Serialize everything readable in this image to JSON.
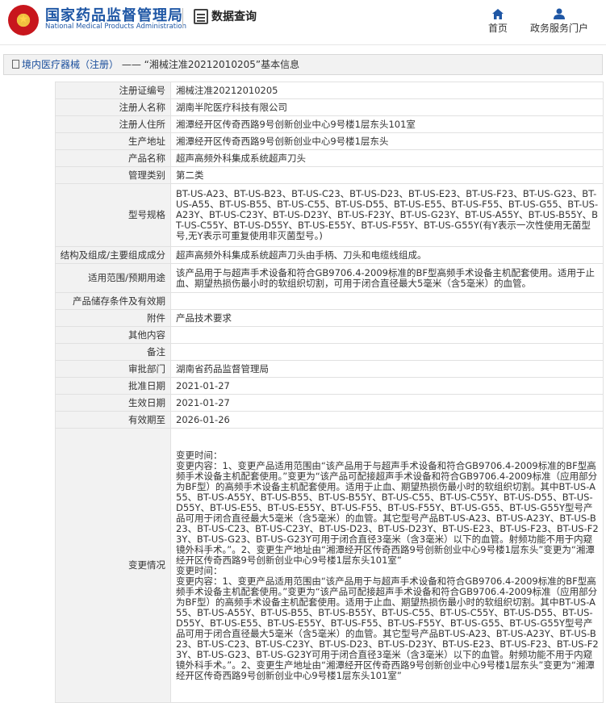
{
  "header": {
    "brand_cn": "国家药品监督管理局",
    "brand_en": "National Medical Products Administration",
    "section_title": "数据查询",
    "nav": {
      "home": "首页",
      "gov": "政务服务门户"
    },
    "brand_color": "#1f57a5"
  },
  "breadcrumb": {
    "category": "境内医疗器械（注册）",
    "sep": " —— ",
    "detail": "“湘械注准20212010205”基本信息"
  },
  "rows": [
    {
      "label": "注册证编号",
      "value": "湘械注准20212010205"
    },
    {
      "label": "注册人名称",
      "value": "湖南半陀医疗科技有限公司"
    },
    {
      "label": "注册人住所",
      "value": "湘潭经开区传奇西路9号创新创业中心9号楼1层东头101室"
    },
    {
      "label": "生产地址",
      "value": "湘潭经开区传奇西路9号创新创业中心9号楼1层东头"
    },
    {
      "label": "产品名称",
      "value": "超声高频外科集成系统超声刀头"
    },
    {
      "label": "管理类别",
      "value": "第二类"
    },
    {
      "label": "型号规格",
      "value": "BT-US-A23、BT-US-B23、BT-US-C23、BT-US-D23、BT-US-E23、BT-US-F23、BT-US-G23、BT-US-A55、BT-US-B55、BT-US-C55、BT-US-D55、BT-US-E55、BT-US-F55、BT-US-G55、BT-US-A23Y、BT-US-C23Y、BT-US-D23Y、BT-US-F23Y、BT-US-G23Y、BT-US-A55Y、BT-US-B55Y、BT-US-C55Y、BT-US-D55Y、BT-US-E55Y、BT-US-F55Y、BT-US-G55Y(有Y表示一次性使用无菌型号,无Y表示可重复使用非灭菌型号。)"
    },
    {
      "label": "结构及组成/主要组成成分",
      "value": "超声高频外科集成系统超声刀头由手柄、刀头和电缆线组成。"
    },
    {
      "label": "适用范围/预期用途",
      "value": "该产品用于与超声手术设备和符合GB9706.4-2009标准的BF型高频手术设备主机配套使用。适用于止血、期望热损伤最小时的软组织切割，可用于闭合直径最大5毫米（含5毫米）的血管。"
    },
    {
      "label": "产品储存条件及有效期",
      "value": ""
    },
    {
      "label": "附件",
      "value": "产品技术要求"
    },
    {
      "label": "其他内容",
      "value": ""
    },
    {
      "label": "备注",
      "value": ""
    },
    {
      "label": "审批部门",
      "value": "湖南省药品监督管理局"
    },
    {
      "label": "批准日期",
      "value": "2021-01-27"
    },
    {
      "label": "生效日期",
      "value": "2021-01-27"
    },
    {
      "label": "有效期至",
      "value": "2026-01-26"
    },
    {
      "label": "变更情况",
      "value": "变更时间：\n变更内容：1、变更产品适用范围由“该产品用于与超声手术设备和符合GB9706.4-2009标准的BF型高频手术设备主机配套使用。”变更为“该产品可配接超声手术设备和符合GB9706.4-2009标准（应用部分为BF型）的高频手术设备主机配套使用。适用于止血、期望热损伤最小时的软组织切割。其中BT-US-A55、BT-US-A55Y、BT-US-B55、BT-US-B55Y、BT-US-C55、BT-US-C55Y、BT-US-D55、BT-US-D55Y、BT-US-E55、BT-US-E55Y、BT-US-F55、BT-US-F55Y、BT-US-G55、BT-US-G55Y型号产品可用于闭合直径最大5毫米（含5毫米）的血管。其它型号产品BT-US-A23、BT-US-A23Y、BT-US-B23、BT-US-C23、BT-US-C23Y、BT-US-D23、BT-US-D23Y、BT-US-E23、BT-US-F23、BT-US-F23Y、BT-US-G23、BT-US-G23Y可用于闭合直径3毫米（含3毫米）以下的血管。射频功能不用于内窥镜外科手术。”。2、变更生产地址由“湘潭经开区传奇西路9号创新创业中心9号楼1层东头”变更为“湘潭经开区传奇西路9号创新创业中心9号楼1层东头101室”\n变更时间：\n变更内容：1、变更产品适用范围由“该产品用于与超声手术设备和符合GB9706.4-2009标准的BF型高频手术设备主机配套使用。”变更为“该产品可配接超声手术设备和符合GB9706.4-2009标准（应用部分为BF型）的高频手术设备主机配套使用。适用于止血、期望热损伤最小时的软组织切割。其中BT-US-A55、BT-US-A55Y、BT-US-B55、BT-US-B55Y、BT-US-C55、BT-US-C55Y、BT-US-D55、BT-US-D55Y、BT-US-E55、BT-US-E55Y、BT-US-F55、BT-US-F55Y、BT-US-G55、BT-US-G55Y型号产品可用于闭合直径最大5毫米（含5毫米）的血管。其它型号产品BT-US-A23、BT-US-A23Y、BT-US-B23、BT-US-C23、BT-US-C23Y、BT-US-D23、BT-US-D23Y、BT-US-E23、BT-US-F23、BT-US-F23Y、BT-US-G23、BT-US-G23Y可用于闭合直径3毫米（含3毫米）以下的血管。射频功能不用于内窥镜外科手术。”。2、变更生产地址由“湘潭经开区传奇西路9号创新创业中心9号楼1层东头”变更为“湘潭经开区传奇西路9号创新创业中心9号楼1层东头101室”"
    }
  ]
}
